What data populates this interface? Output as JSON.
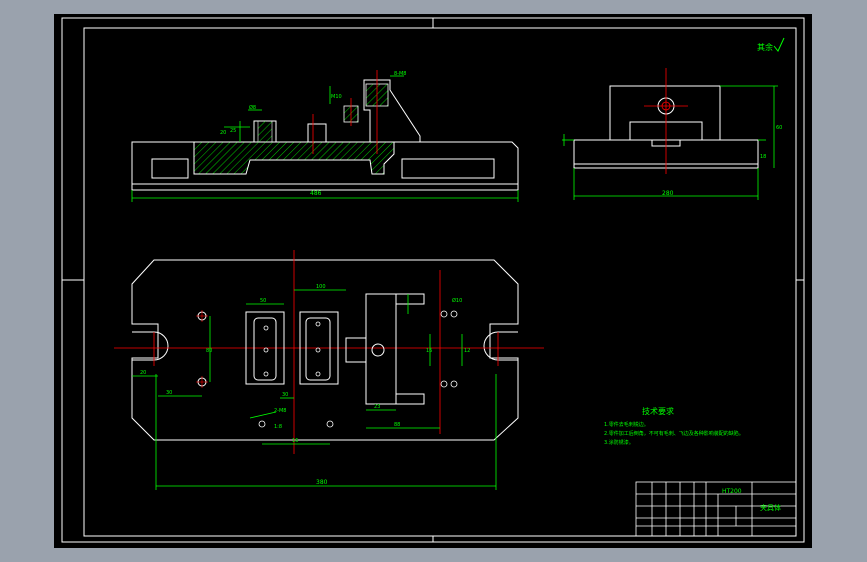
{
  "colors": {
    "background": "#000000",
    "outer_frame": "#9aa2ad",
    "outline": "#ffffff",
    "dimension": "#00ff00",
    "centerline": "#ff0000",
    "hatch": "#00ff00",
    "text": "#00ff00"
  },
  "roughness_mark": "其余",
  "front_view": {
    "overall_dim": "486",
    "dims": [
      "8-M8",
      "M10",
      "Ø8",
      "25",
      "20"
    ]
  },
  "side_view": {
    "overall_dim": "280",
    "dims": [
      "60",
      "18"
    ]
  },
  "plan_view": {
    "overall_dim": "380",
    "dims": [
      "20",
      "30",
      "80",
      "100",
      "50",
      "Ø10",
      "16",
      "12",
      "23",
      "88",
      "30",
      "2-M8",
      "1:8",
      "16"
    ]
  },
  "notes": {
    "title": "技术要求",
    "items": [
      "1.零件去毛刺锐边。",
      "2.零件加工后倒角，不可有毛刺、飞边及各种影响装配的缺陷。",
      "3.涂防锈漆。"
    ]
  },
  "title_block": {
    "drawing_name": "夹具体",
    "material": "HT200"
  }
}
